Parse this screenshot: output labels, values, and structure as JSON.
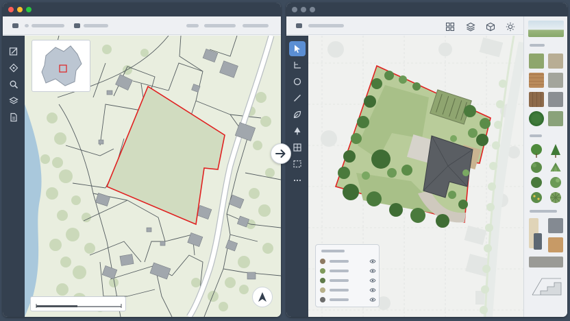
{
  "colors": {
    "window_frame": "#34404f",
    "parcel_outline": "#e02020",
    "accent_tool": "#5b8fd4",
    "mac_close": "#ff5f57",
    "mac_minimize": "#febc2e",
    "mac_maximize": "#28c840"
  },
  "left_window": {
    "tools": [
      "edit-plan-icon",
      "pen-node-icon",
      "search-icon",
      "layers-icon",
      "document-icon"
    ],
    "has_minimap": true,
    "has_scalebar": true
  },
  "transition_icon": "arrow-right-icon",
  "right_window": {
    "top_icons": [
      "grid-view-icon",
      "layers-icon",
      "cube-3d-icon",
      "sun-icon"
    ],
    "tools": [
      "select-arrow-icon",
      "angle-measure-icon",
      "circle-icon",
      "line-icon",
      "leaf-icon",
      "tree-icon",
      "window-grid-icon",
      "dashed-rect-icon",
      "more-icon"
    ],
    "layer_swatches": [
      "#8d7a62",
      "#7f9a5c",
      "#5f7a4a",
      "#b7b08a",
      "#6d6d6d"
    ],
    "material_swatches": [
      "#9bb07a",
      "#b7ab90",
      "#b98a5a",
      "#a3a59c",
      "#8d6a4a",
      "#8b8f93",
      "#2f6a2e",
      "#8aa27a"
    ],
    "plant_icons": [
      "deciduous-tree-icon",
      "conifer-tree-icon",
      "round-shrub-icon",
      "grass-clump-icon",
      "shrub-icon",
      "shrub-icon",
      "flower-plant-icon",
      "succulent-icon"
    ]
  }
}
